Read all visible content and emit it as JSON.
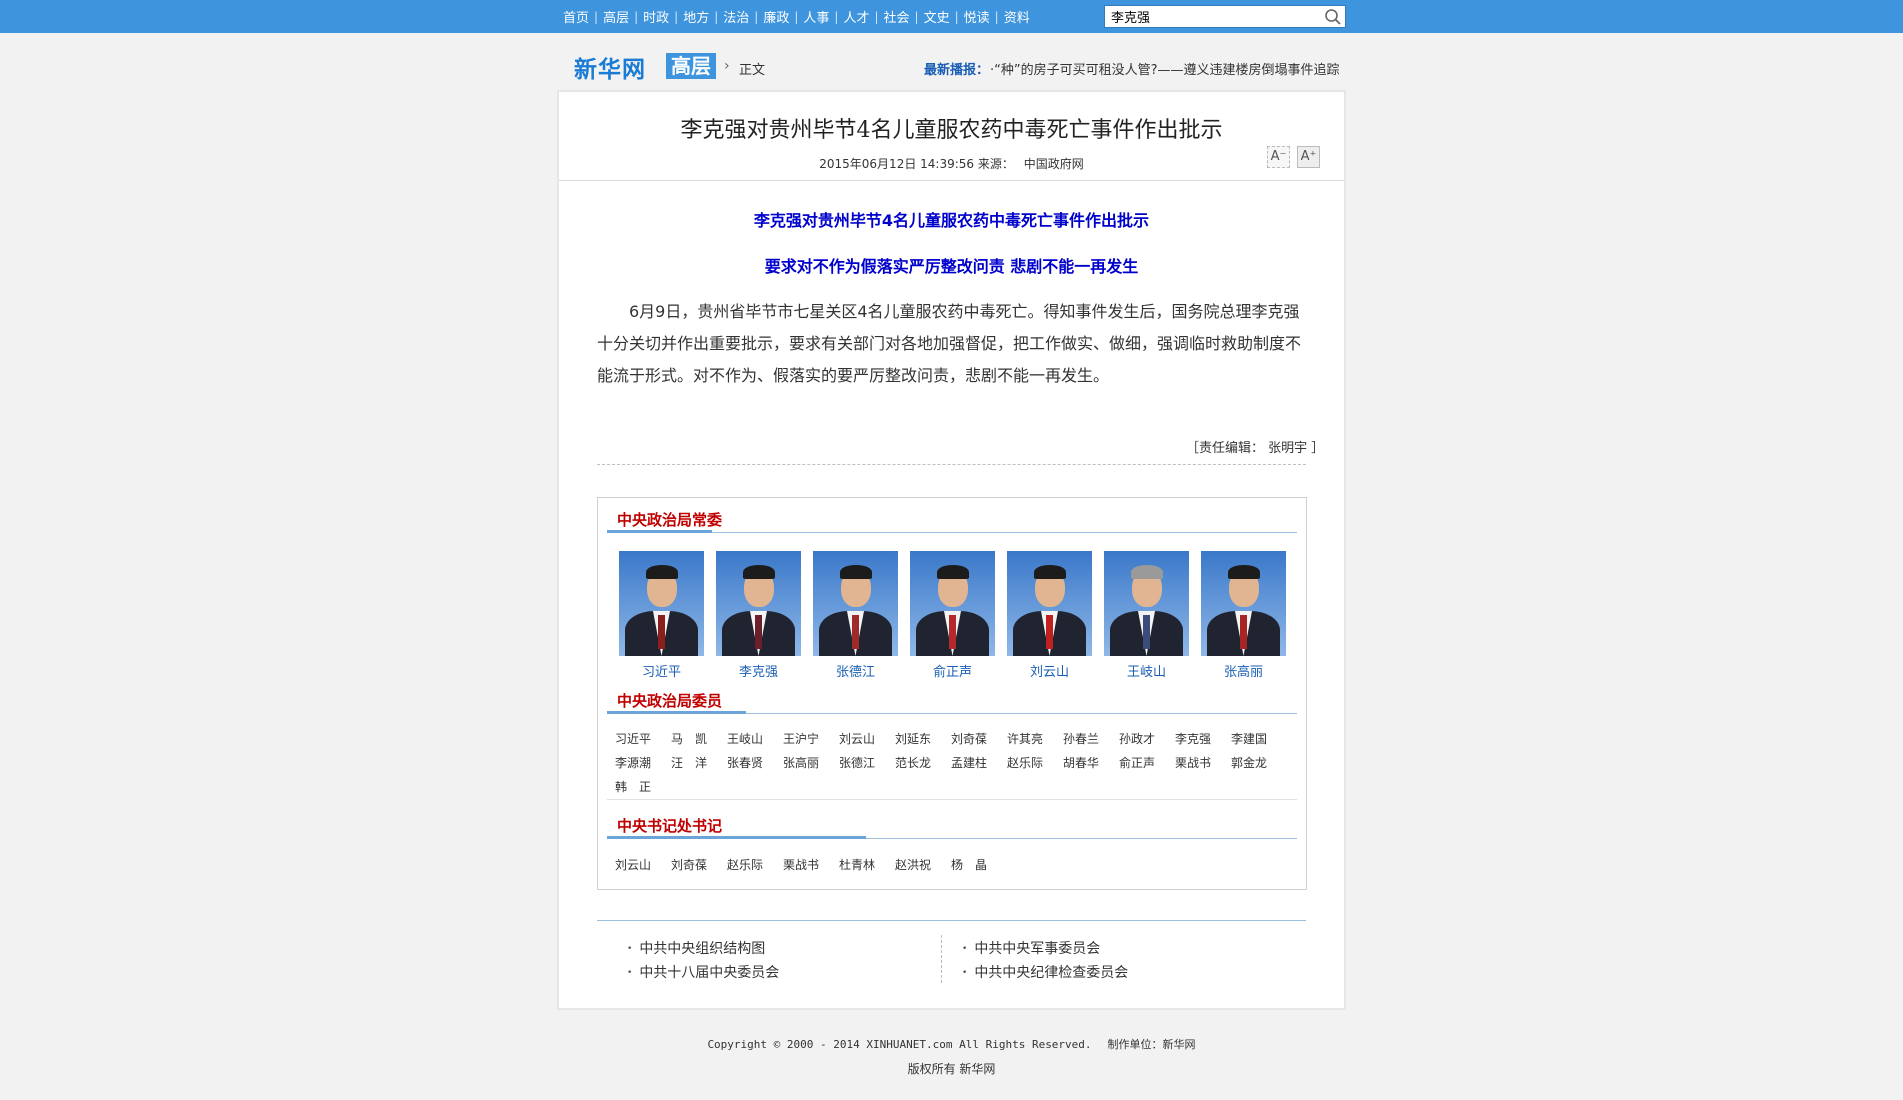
{
  "nav": {
    "items": [
      "首页",
      "高层",
      "时政",
      "地方",
      "法治",
      "廉政",
      "人事",
      "人才",
      "社会",
      "文史",
      "悦读",
      "资料"
    ],
    "search_value": "李克强"
  },
  "header": {
    "logo": "新华网",
    "section": "高层",
    "crumb": "正文",
    "latest_label": "最新播报：",
    "latest_text": "·“种”的房子可买可租没人管?——遵义违建楼房倒塌事件追踪"
  },
  "article": {
    "title": "李克强对贵州毕节4名儿童服农药中毒死亡事件作出批示",
    "date": "2015年06月12日 14:39:56",
    "source_label": "来源：",
    "source": "中国政府网",
    "font_small": "A⁻",
    "font_big": "A⁺",
    "subtitle1": "李克强对贵州毕节4名儿童服农药中毒死亡事件作出批示",
    "subtitle2": "要求对不作为假落实严厉整改问责 悲剧不能一再发生",
    "body": "6月9日，贵州省毕节市七星关区4名儿童服农药中毒死亡。得知事件发生后，国务院总理李克强十分关切并作出重要批示，要求有关部门对各地加强督促，把工作做实、做细，强调临时救助制度不能流于形式。对不作为、假落实的要严厉整改问责，悲剧不能一再发生。",
    "editor": "［责任编辑： 张明宇 ］"
  },
  "leaders": {
    "standing_title": "中央政治局常委",
    "standing": [
      "习近平",
      "李克强",
      "张德江",
      "俞正声",
      "刘云山",
      "王岐山",
      "张高丽"
    ],
    "members_title": "中央政治局委员",
    "members_row1": [
      "习近平",
      "马　凯",
      "王岐山",
      "王沪宁",
      "刘云山",
      "刘延东",
      "刘奇葆",
      "许其亮",
      "孙春兰",
      "孙政才",
      "李克强",
      "李建国"
    ],
    "members_row2": [
      "李源潮",
      "汪　洋",
      "张春贤",
      "张高丽",
      "张德江",
      "范长龙",
      "孟建柱",
      "赵乐际",
      "胡春华",
      "俞正声",
      "栗战书",
      "郭金龙"
    ],
    "members_row3": [
      "韩　正"
    ],
    "secretariat_title": "中央书记处书记",
    "secretariat": [
      "刘云山",
      "刘奇葆",
      "赵乐际",
      "栗战书",
      "杜青林",
      "赵洪祝",
      "杨　晶"
    ]
  },
  "links": {
    "left": [
      "中共中央组织结构图",
      "中共十八届中央委员会"
    ],
    "right": [
      "中共中央军事委员会",
      "中共中央纪律检查委员会"
    ]
  },
  "footer": {
    "copyright": "Copyright © 2000 - 2014 XINHUANET.com  All Rights Reserved.",
    "maker": "制作单位：新华网",
    "rights": "版权所有  新华网"
  }
}
